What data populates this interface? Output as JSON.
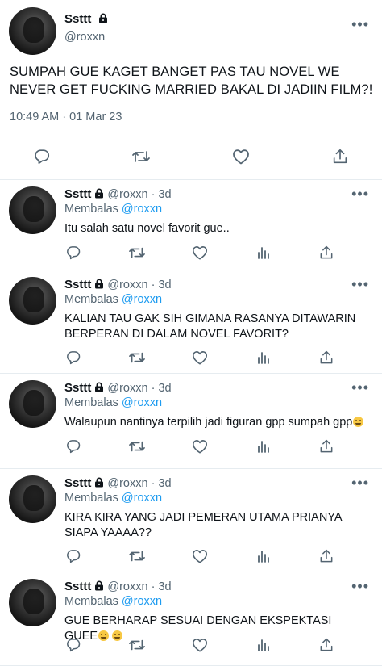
{
  "main_tweet": {
    "name": "Ssttt",
    "handle": "@roxxn",
    "text": "SUMPAH GUE KAGET BANGET PAS TAU NOVEL WE NEVER GET FUCKING MARRIED BAKAL DI JADIIN FILM?!",
    "timestamp": "10:49 AM · 01 Mar 23",
    "more": "•••"
  },
  "reply_prefix": "Membalas",
  "replies": [
    {
      "name": "Ssttt",
      "handle": "@roxxn",
      "age": "· 3d",
      "reply_to": "@roxxn",
      "text": "Itu salah satu novel favorit gue..",
      "emoji_count": 0
    },
    {
      "name": "Ssttt",
      "handle": "@roxxn",
      "age": "· 3d",
      "reply_to": "@roxxn",
      "text": "KALIAN TAU GAK SIH GIMANA RASANYA DITAWARIN BERPERAN DI DALAM NOVEL FAVORIT?",
      "emoji_count": 0
    },
    {
      "name": "Ssttt",
      "handle": "@roxxn",
      "age": "· 3d",
      "reply_to": "@roxxn",
      "text": "Walaupun nantinya terpilih jadi figuran gpp sumpah gpp",
      "emoji_count": 1
    },
    {
      "name": "Ssttt",
      "handle": "@roxxn",
      "age": "· 3d",
      "reply_to": "@roxxn",
      "text": "KIRA KIRA YANG JADI PEMERAN UTAMA PRIANYA SIAPA YAAAA??",
      "emoji_count": 0
    },
    {
      "name": "Ssttt",
      "handle": "@roxxn",
      "age": "· 3d",
      "reply_to": "@roxxn",
      "text": "GUE BERHARAP SESUAI DENGAN EKSPEKTASI GUEE",
      "emoji_count": 2
    }
  ],
  "icons": {
    "reply": "reply-icon",
    "retweet": "retweet-icon",
    "like": "heart-icon",
    "views": "analytics-icon",
    "share": "share-icon",
    "lock": "lock-icon",
    "emoji": "loudly-crying-face-emoji"
  },
  "colors": {
    "text": "#0f1419",
    "secondary": "#536471",
    "link": "#1d9bf0",
    "divider": "#e6ecf0"
  }
}
